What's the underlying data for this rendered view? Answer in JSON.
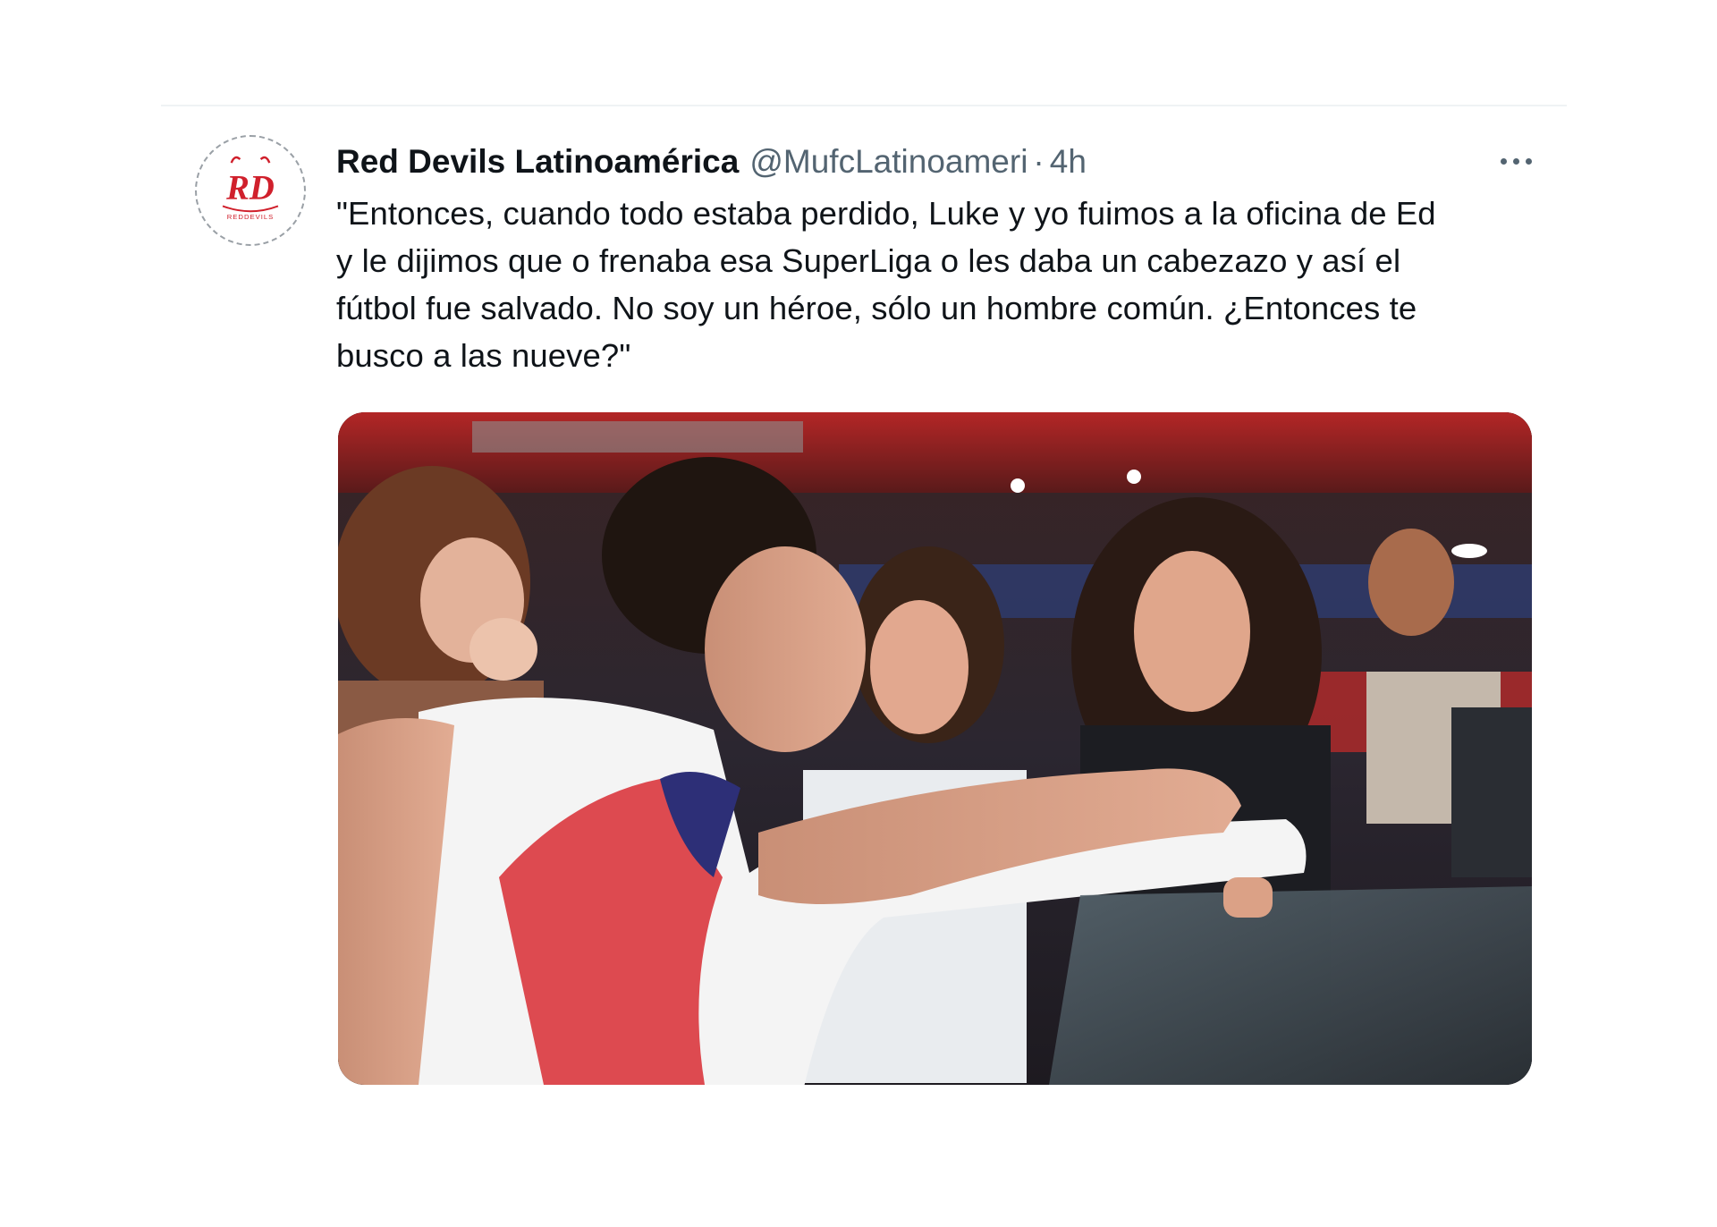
{
  "tweet": {
    "display_name": "Red Devils Latinoamérica",
    "handle": "@MufcLatinoameri",
    "separator": "·",
    "timestamp": "4h",
    "text": "\"Entonces, cuando todo estaba perdido, Luke y yo fuimos a la oficina de Ed\ny le dijimos que o frenaba esa SuperLiga o les daba un cabezazo y así el\nfútbol fue salvado. No soy un héroe, sólo un hombre común. ¿Entonces te\nbusco a las nueve?\"",
    "avatar_logo_text": "RD",
    "avatar_logo_subtext": "REDDEVILS",
    "media_alt": "",
    "icons": {
      "more": "more-horizontal-icon"
    }
  },
  "colors": {
    "text_primary": "#0f1419",
    "text_secondary": "#536471",
    "brand_red": "#d0202c"
  }
}
